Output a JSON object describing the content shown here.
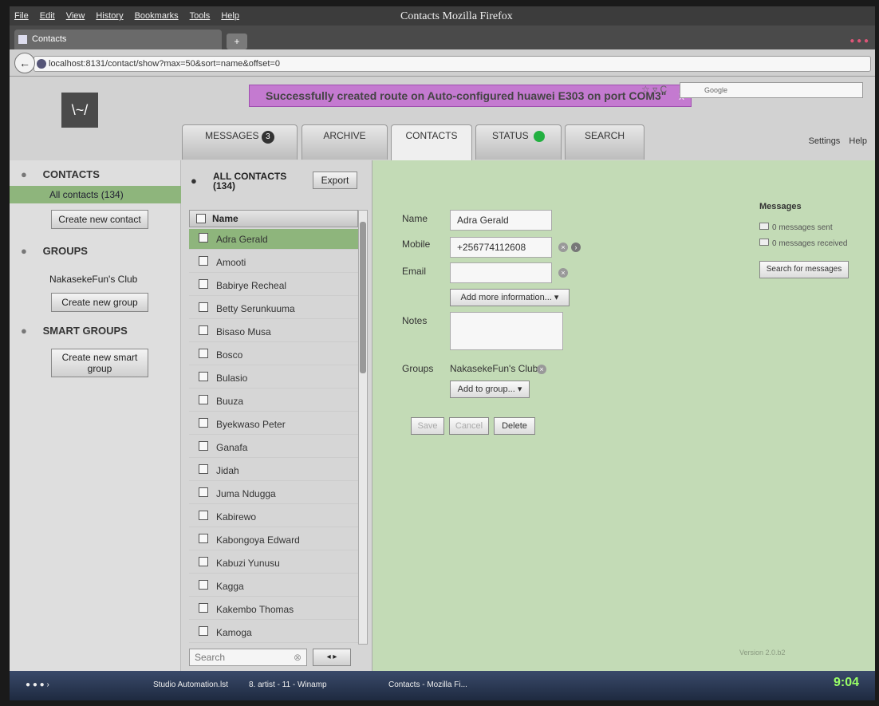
{
  "window": {
    "title": "Contacts  Mozilla Firefox"
  },
  "menu": [
    "File",
    "Edit",
    "View",
    "History",
    "Bookmarks",
    "Tools",
    "Help"
  ],
  "browser_tab": {
    "label": "Contacts",
    "new_tab": "+"
  },
  "url": "localhost:8131/contact/show?max=50&sort=name&offset=0",
  "search_engine": "Google",
  "flash_message": "Successfully created route on Auto-configured huawei E303 on port COM3\"",
  "flash_close": "x",
  "header_links": {
    "settings": "Settings",
    "help": "Help"
  },
  "tabs": {
    "messages": "MESSAGES",
    "messages_count": "3",
    "archive": "ARCHIVE",
    "contacts": "CONTACTS",
    "status": "STATUS",
    "search": "SEARCH"
  },
  "sidebar": {
    "contacts_heading": "CONTACTS",
    "all_contacts": "All contacts (134)",
    "create_contact": "Create new contact",
    "groups_heading": "GROUPS",
    "group_item": "NakasekeFun's Club",
    "create_group": "Create new group",
    "smart_heading": "SMART GROUPS",
    "create_smart": "Create new smart group"
  },
  "contact_list": {
    "title": "ALL CONTACTS",
    "count": "(134)",
    "export": "Export",
    "column": "Name",
    "search_placeholder": "Search",
    "rows": [
      "Adra Gerald",
      "Amooti",
      "Babirye Recheal",
      "Betty Serunkuuma",
      "Bisaso Musa",
      "Bosco",
      "Bulasio",
      "Buuza",
      "Byekwaso Peter",
      "Ganafa",
      "Jidah",
      "Juma Ndugga",
      "Kabirewo",
      "Kabongoya Edward",
      "Kabuzi Yunusu",
      "Kagga",
      "Kakembo Thomas",
      "Kamoga"
    ]
  },
  "detail": {
    "name_label": "Name",
    "name_value": "Adra Gerald",
    "mobile_label": "Mobile",
    "mobile_value": "+256774112608",
    "email_label": "Email",
    "email_value": "",
    "add_info": "Add more information...",
    "notes_label": "Notes",
    "groups_label": "Groups",
    "group_value": "NakasekeFun's Club",
    "add_group": "Add to group...",
    "save": "Save",
    "cancel": "Cancel",
    "delete": "Delete"
  },
  "messages_panel": {
    "heading": "Messages",
    "sent": "0 messages sent",
    "received": "0 messages received",
    "search_button": "Search for messages"
  },
  "version": "Version 2.0.b2",
  "taskbar": {
    "items": [
      "Studio Automation.lst",
      "8. artist - 11 - Winamp",
      "Contacts - Mozilla Fi..."
    ],
    "clock": "9:04"
  }
}
